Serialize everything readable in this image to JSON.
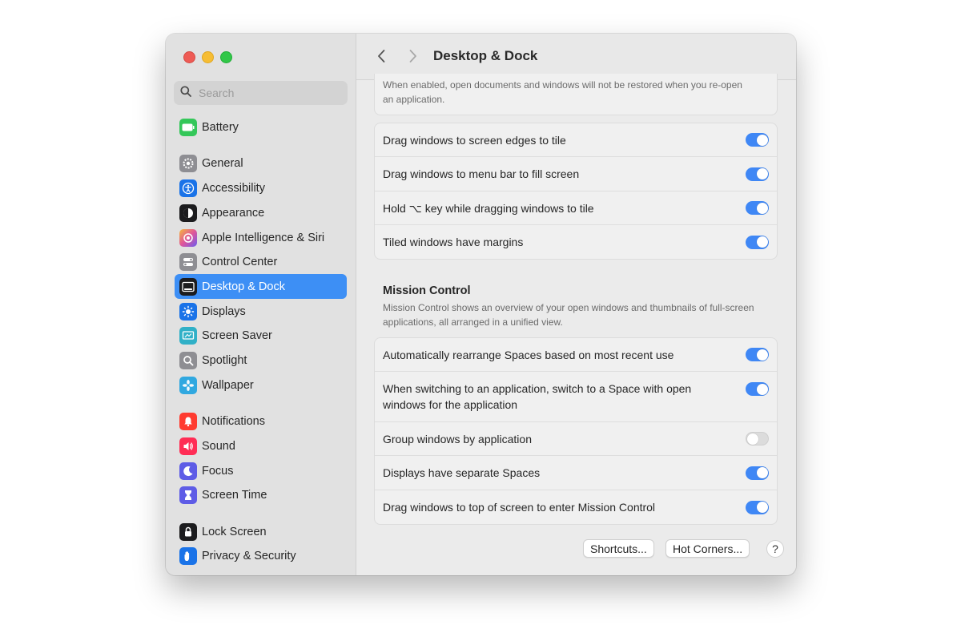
{
  "window": {
    "title": "Desktop & Dock"
  },
  "search": {
    "placeholder": "Search"
  },
  "sidebar": {
    "items": [
      {
        "label": "Battery",
        "icon": "battery-icon",
        "color": "#34c759"
      },
      {
        "label": "General",
        "icon": "gear-icon",
        "color": "#8e8e93"
      },
      {
        "label": "Accessibility",
        "icon": "accessibility-icon",
        "color": "#1a73e8"
      },
      {
        "label": "Appearance",
        "icon": "appearance-icon",
        "color": "#1c1c1e"
      },
      {
        "label": "Apple Intelligence & Siri",
        "icon": "siri-icon",
        "color": "#e0559a"
      },
      {
        "label": "Control Center",
        "icon": "control-center-icon",
        "color": "#8e8e93"
      },
      {
        "label": "Desktop & Dock",
        "icon": "dock-icon",
        "color": "#1c1c1e",
        "selected": true
      },
      {
        "label": "Displays",
        "icon": "sun-icon",
        "color": "#1a73e8"
      },
      {
        "label": "Screen Saver",
        "icon": "screen-saver-icon",
        "color": "#30b0c7"
      },
      {
        "label": "Spotlight",
        "icon": "magnifier-icon",
        "color": "#8e8e93"
      },
      {
        "label": "Wallpaper",
        "icon": "flower-icon",
        "color": "#30a8e0"
      },
      {
        "label": "Notifications",
        "icon": "bell-icon",
        "color": "#ff3b30"
      },
      {
        "label": "Sound",
        "icon": "speaker-icon",
        "color": "#ff2d55"
      },
      {
        "label": "Focus",
        "icon": "moon-icon",
        "color": "#5e5ce6"
      },
      {
        "label": "Screen Time",
        "icon": "hourglass-icon",
        "color": "#5e5ce6"
      },
      {
        "label": "Lock Screen",
        "icon": "lock-icon",
        "color": "#1c1c1e"
      },
      {
        "label": "Privacy & Security",
        "icon": "hand-icon",
        "color": "#1a73e8"
      }
    ]
  },
  "main": {
    "top_description": "When enabled, open documents and windows will not be restored when you re-open an application.",
    "tiling": [
      {
        "label": "Drag windows to screen edges to tile",
        "on": true
      },
      {
        "label": "Drag windows to menu bar to fill screen",
        "on": true
      },
      {
        "label": "Hold ⌥ key while dragging windows to tile",
        "on": true
      },
      {
        "label": "Tiled windows have margins",
        "on": true
      }
    ],
    "mission_control": {
      "title": "Mission Control",
      "description": "Mission Control shows an overview of your open windows and thumbnails of full-screen applications, all arranged in a unified view.",
      "rows": [
        {
          "label": "Automatically rearrange Spaces based on most recent use",
          "on": true
        },
        {
          "label": "When switching to an application, switch to a Space with open windows for the application",
          "on": true
        },
        {
          "label": "Group windows by application",
          "on": false
        },
        {
          "label": "Displays have separate Spaces",
          "on": true
        },
        {
          "label": "Drag windows to top of screen to enter Mission Control",
          "on": true
        }
      ]
    },
    "buttons": {
      "shortcuts": "Shortcuts...",
      "hot_corners": "Hot Corners...",
      "help": "?"
    }
  },
  "colors": {
    "accent": "#3d8ff5",
    "toggle_on": "#3f87f5"
  }
}
